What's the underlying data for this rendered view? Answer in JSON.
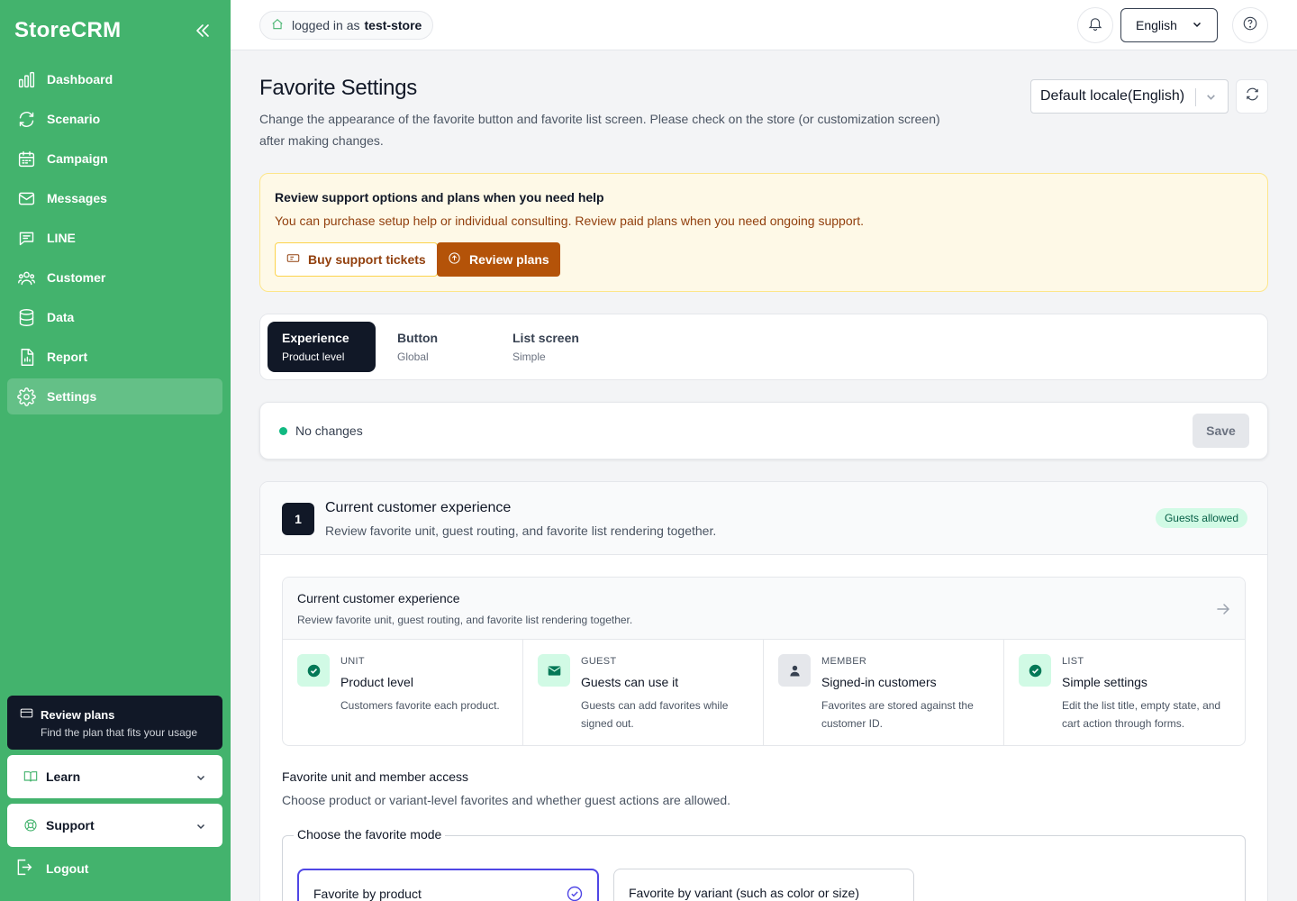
{
  "brand": "StoreCRM",
  "colors": {
    "sidebar": "#43b36d",
    "dark": "#111827",
    "accent": "#b45309",
    "success": "#10b981",
    "selection": "#4f46e5"
  },
  "sidebar": {
    "items": [
      {
        "label": "Dashboard",
        "icon": "bar-chart-icon"
      },
      {
        "label": "Scenario",
        "icon": "refresh-cycle-icon"
      },
      {
        "label": "Campaign",
        "icon": "calendar-icon"
      },
      {
        "label": "Messages",
        "icon": "envelope-icon"
      },
      {
        "label": "LINE",
        "icon": "chat-bubble-icon"
      },
      {
        "label": "Customer",
        "icon": "users-icon"
      },
      {
        "label": "Data",
        "icon": "database-icon"
      },
      {
        "label": "Report",
        "icon": "document-icon"
      },
      {
        "label": "Settings",
        "icon": "gear-icon",
        "active": true
      }
    ],
    "plan": {
      "title": "Review plans",
      "subtitle": "Find the plan that fits your usage"
    },
    "learn": "Learn",
    "support": "Support",
    "logout": "Logout"
  },
  "header": {
    "logged_in_prefix": "logged in as",
    "store": "test-store",
    "language": "English"
  },
  "page": {
    "title": "Favorite Settings",
    "description": "Change the appearance of the favorite button and favorite list screen. Please check on the store (or customization screen) after making changes.",
    "locale": "Default locale(English)"
  },
  "notice": {
    "title": "Review support options and plans when you need help",
    "description": "You can purchase setup help or individual consulting. Review paid plans when you need ongoing support.",
    "buy_label": "Buy support tickets",
    "plans_label": "Review plans"
  },
  "tabs": [
    {
      "label": "Experience",
      "sub": "Product level",
      "active": true
    },
    {
      "label": "Button",
      "sub": "Global"
    },
    {
      "label": "List screen",
      "sub": "Simple"
    }
  ],
  "savebar": {
    "status": "No changes",
    "save_label": "Save"
  },
  "section": {
    "number": "1",
    "title": "Current customer experience",
    "description": "Review favorite unit, guest routing, and favorite list rendering together.",
    "badge": "Guests allowed",
    "summary": {
      "title": "Current customer experience",
      "description": "Review favorite unit, guest routing, and favorite list rendering together.",
      "cells": [
        {
          "key": "UNIT",
          "value": "Product level",
          "desc": "Customers favorite each product.",
          "icon": "check-circle-icon"
        },
        {
          "key": "GUEST",
          "value": "Guests can use it",
          "desc": "Guests can add favorites while signed out.",
          "icon": "envelope-icon"
        },
        {
          "key": "MEMBER",
          "value": "Signed-in customers",
          "desc": "Favorites are stored against the customer ID.",
          "icon": "person-icon"
        },
        {
          "key": "LIST",
          "value": "Simple settings",
          "desc": "Edit the list title, empty state, and cart action through forms.",
          "icon": "check-circle-icon"
        }
      ]
    },
    "unit_title": "Favorite unit and member access",
    "unit_desc": "Choose product or variant-level favorites and whether guest actions are allowed.",
    "mode_legend": "Choose the favorite mode",
    "mode_options": [
      {
        "label": "Favorite by product",
        "selected": true
      },
      {
        "label": "Favorite by variant (such as color or size)",
        "selected": false
      }
    ]
  }
}
